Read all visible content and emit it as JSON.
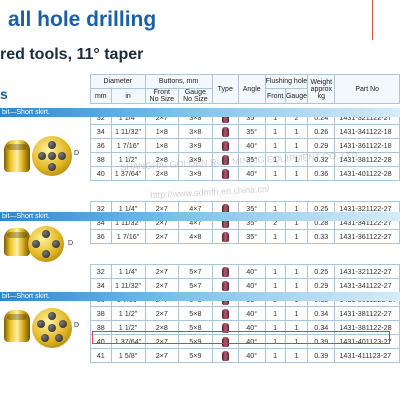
{
  "title": "all hole drilling",
  "subtitle": "red tools, 11° taper",
  "corner_letter": "s",
  "header": {
    "diameter": "Diameter",
    "mm": "mm",
    "in": "in",
    "buttons": "Buttons, mm",
    "front": "Front",
    "front_sub": "No Size",
    "gauge": "Gauge",
    "gauge_sub": "No Size",
    "type": "Type",
    "angle": "Angle",
    "flushing": "Flushing hole",
    "fl_front": "Front",
    "fl_gauge": "Gauge",
    "weight": "Weight",
    "weight_sub": "approx",
    "weight_unit": "kg",
    "part": "Part No"
  },
  "sections": [
    {
      "label": "bit—Short skirt.",
      "rows": [
        [
          "32",
          "1 1/4\"",
          "2×7",
          "3×8",
          "35°",
          "1",
          "2",
          "0.24",
          "1431-321122-27"
        ],
        [
          "34",
          "1 11/32\"",
          "1×8",
          "3×8",
          "35°",
          "1",
          "1",
          "0.26",
          "1431-341122-18"
        ],
        [
          "36",
          "1 7/16\"",
          "1×8",
          "3×9",
          "40°",
          "1",
          "1",
          "0.29",
          "1431-361122-18"
        ],
        [
          "38",
          "1 1/2\"",
          "2×8",
          "3×9",
          "35°",
          "1",
          "1",
          "0.32",
          "1431-381122-28"
        ],
        [
          "40",
          "1 37/64\"",
          "2×8",
          "3×9",
          "40°",
          "1",
          "1",
          "0.36",
          "1431-401122-28"
        ]
      ]
    },
    {
      "label": "bit—Short skirt.",
      "rows": [
        [
          "32",
          "1 1/4\"",
          "2×7",
          "4×7",
          "35°",
          "1",
          "1",
          "0.25",
          "1431-321122-27"
        ],
        [
          "34",
          "1 11/32\"",
          "2×7",
          "4×7",
          "35°",
          "2",
          "1",
          "0.28",
          "1431-341122-27"
        ],
        [
          "36",
          "1 7/16\"",
          "2×7",
          "4×8",
          "35°",
          "1",
          "1",
          "0.33",
          "1431-361122-27"
        ]
      ]
    },
    {
      "label": "bit—Short skirt.",
      "rows": [
        [
          "32",
          "1 1/4\"",
          "2×7",
          "5×7",
          "40°",
          "1",
          "1",
          "0.25",
          "1431-321122-27"
        ],
        [
          "34",
          "1 11/32\"",
          "2×7",
          "5×7",
          "40°",
          "1",
          "1",
          "0.29",
          "1431-341122-27"
        ],
        [
          "36",
          "1 7/16\"",
          "2×7",
          "5×8",
          "35°",
          "2",
          "1",
          "0.32",
          "1431-361122B-27"
        ],
        [
          "38",
          "1 1/2\"",
          "2×7",
          "5×8",
          "40°",
          "1",
          "1",
          "0.34",
          "1431-381122-27"
        ],
        [
          "38",
          "1 1/2\"",
          "2×8",
          "5×8",
          "40°",
          "1",
          "1",
          "0.34",
          "1431-381122-28"
        ],
        [
          "40",
          "1 37/64\"",
          "2×7",
          "5×9",
          "40°",
          "1",
          "1",
          "0.39",
          "1431-401123-27"
        ],
        [
          "41",
          "1 5/8\"",
          "2×7",
          "5×9",
          "40°",
          "1",
          "1",
          "0.39",
          "1431-411123-27"
        ]
      ]
    }
  ],
  "diameter_label": "D",
  "watermark1": "SHANGHAI GOLDEN RUN MINING EQUIPMENT CO.,LTD",
  "watermark2": "http://www.sdmfh.en.china.cn/",
  "colors": {
    "accent": "#1a5fa8",
    "grid": "#a9c6df",
    "highlight": "#e03a3a"
  }
}
